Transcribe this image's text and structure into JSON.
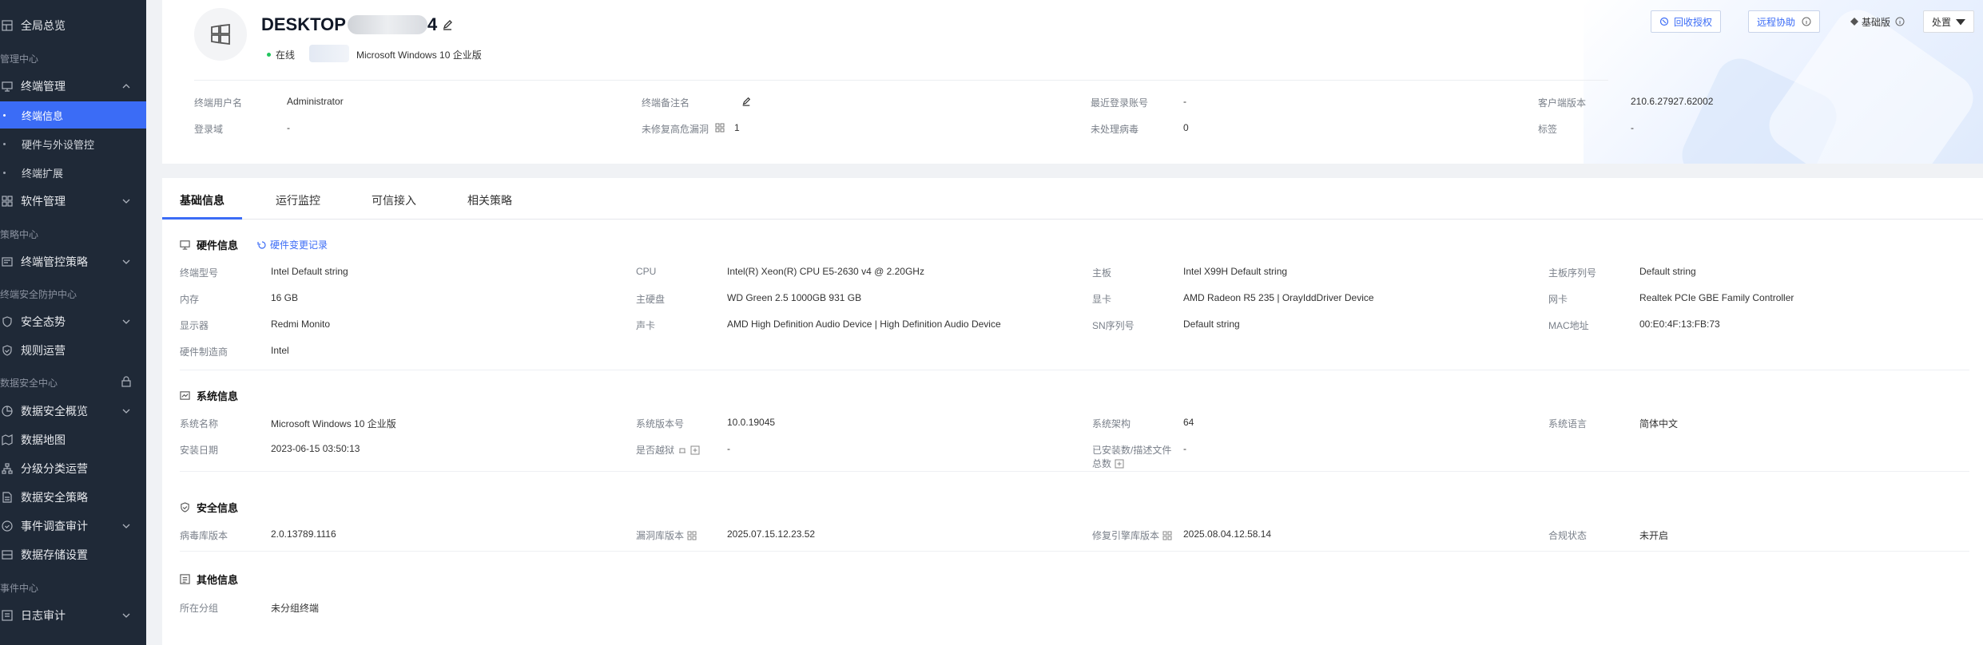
{
  "sidebar": {
    "home": "全局总览",
    "group_manage": "管理中心",
    "terminal_manage": "终端管理",
    "terminal_info": "终端信息",
    "hw_control": "硬件与外设管控",
    "terminal_ext": "终端扩展",
    "software_manage": "软件管理",
    "group_policy": "策略中心",
    "terminal_policy": "终端管控策略",
    "group_security": "终端安全防护中心",
    "security_posture": "安全态势",
    "rule_ops": "规则运营",
    "group_data": "数据安全中心",
    "data_overview": "数据安全概览",
    "data_map": "数据地图",
    "classify_ops": "分级分类运营",
    "data_policy": "数据安全策略",
    "event_audit": "事件调查审计",
    "data_storage": "数据存储设置",
    "group_event": "事件中心",
    "log_audit": "日志审计"
  },
  "header": {
    "hostname": "DESKTOP",
    "hostname_suffix": "4",
    "status": "在线",
    "os": "Microsoft Windows 10 企业版",
    "btn_revoke": "回收授权",
    "btn_remote": "远程协助",
    "edition": "基础版",
    "btn_action": "处置",
    "fields": {
      "user_k": "终端用户名",
      "user_v": "Administrator",
      "note_k": "终端备注名",
      "last_login_k": "最近登录账号",
      "last_login_v": "-",
      "client_ver_k": "客户端版本",
      "client_ver_v": "210.6.27927.62002",
      "domain_k": "登录域",
      "domain_v": "-",
      "vuln_k": "未修复高危漏洞",
      "vuln_v": "1",
      "virus_k": "未处理病毒",
      "virus_v": "0",
      "tag_k": "标签",
      "tag_v": "-"
    }
  },
  "tabs": [
    "基础信息",
    "运行监控",
    "可信接入",
    "相关策略"
  ],
  "hardware": {
    "title": "硬件信息",
    "link": "硬件变更记录",
    "rows": [
      [
        [
          "终端型号",
          "Intel Default string"
        ],
        [
          "CPU",
          "Intel(R) Xeon(R) CPU E5-2630 v4 @ 2.20GHz"
        ],
        [
          "主板",
          "Intel X99H Default string"
        ],
        [
          "主板序列号",
          "Default string"
        ]
      ],
      [
        [
          "内存",
          "16 GB"
        ],
        [
          "主硬盘",
          "WD Green 2.5 1000GB 931 GB"
        ],
        [
          "显卡",
          "AMD Radeon R5 235 | OrayIddDriver Device"
        ],
        [
          "网卡",
          "Realtek PCIe GBE Family Controller"
        ]
      ],
      [
        [
          "显示器",
          "Redmi Monito"
        ],
        [
          "声卡",
          "AMD High Definition Audio Device | High Definition Audio Device"
        ],
        [
          "SN序列号",
          "Default string"
        ],
        [
          "MAC地址",
          "00:E0:4F:13:FB:73"
        ]
      ],
      [
        [
          "硬件制造商",
          "Intel"
        ]
      ]
    ]
  },
  "system": {
    "title": "系统信息",
    "rows": [
      [
        [
          "系统名称",
          "Microsoft Windows 10 企业版"
        ],
        [
          "系统版本号",
          "10.0.19045"
        ],
        [
          "系统架构",
          "64"
        ],
        [
          "系统语言",
          "简体中文"
        ]
      ],
      [
        [
          "安装日期",
          "2023-06-15 03:50:13"
        ],
        [
          "是否越狱",
          "-"
        ],
        [
          "已安装数/描述文件",
          "-"
        ]
      ]
    ],
    "extra_label_line2": "总数"
  },
  "security": {
    "title": "安全信息",
    "rows": [
      [
        [
          "病毒库版本",
          "2.0.13789.1116"
        ],
        [
          "漏洞库版本",
          "2025.07.15.12.23.52"
        ],
        [
          "修复引擎库版本",
          "2025.08.04.12.58.14"
        ],
        [
          "合规状态",
          "未开启"
        ]
      ]
    ]
  },
  "other": {
    "title": "其他信息",
    "rows": [
      [
        [
          "所在分组",
          "未分组终端"
        ]
      ]
    ]
  }
}
